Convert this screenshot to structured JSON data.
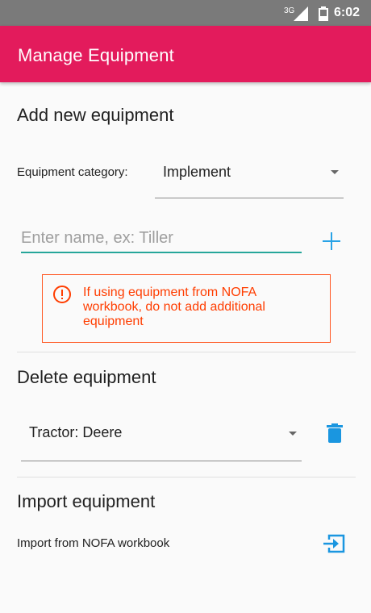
{
  "status_bar": {
    "network": "3G",
    "time": "6:02",
    "signal_icon": "signal-icon",
    "battery_icon": "battery-icon"
  },
  "app_bar": {
    "title": "Manage Equipment",
    "background_color": "#e31b5c"
  },
  "add_section": {
    "title": "Add new equipment",
    "category_label": "Equipment category:",
    "category_value": "Implement",
    "name_placeholder": "Enter name, ex: Tiller",
    "name_value": "",
    "add_icon": "plus-icon",
    "warning": {
      "icon": "error-circle-icon",
      "text": "If using equipment from NOFA workbook, do not add additional equipment",
      "color": "#ff3d00"
    }
  },
  "delete_section": {
    "title": "Delete equipment",
    "selected_value": "Tractor: Deere",
    "delete_icon": "trash-icon"
  },
  "import_section": {
    "title": "Import equipment",
    "label": "Import from NOFA workbook",
    "import_icon": "import-icon"
  },
  "colors": {
    "accent": "#29a3e6",
    "input_underline": "#26a69a"
  }
}
